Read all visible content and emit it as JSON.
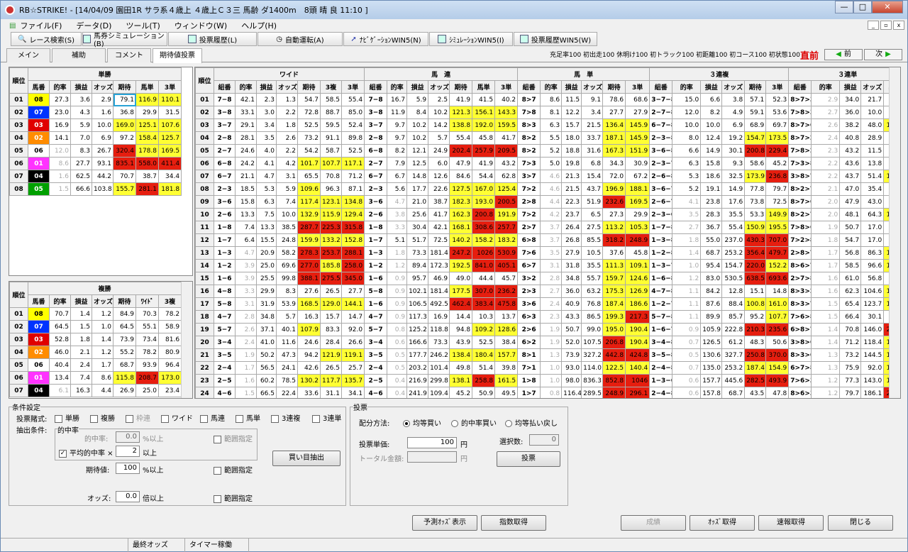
{
  "window": {
    "title": "RB☆STRIKE! - [14/04/09 園田1R サラ系４歳上 ４歳上Ｃ３三 馬齢 ダ1400m　8頭 晴 良 11:10 ]",
    "min": "—",
    "max": "□",
    "close": "✕"
  },
  "menu": [
    "ファイル(F)",
    "データ(D)",
    "ツール(T)",
    "ウィンドウ(W)",
    "ヘルプ(H)"
  ],
  "mdi": [
    "_",
    "▫",
    "x"
  ],
  "toolbar": [
    "レース検索(S)",
    "馬券シミュレーション(B)",
    "投票履歴(L)",
    "自動運転(A)",
    "ﾅﾋﾞｹﾞｰｼｮﾝWIN5(N)",
    "ｼﾐｭﾚｰｼｮﾝWIN5(I)",
    "投票履歴WIN5(W)"
  ],
  "tabs": [
    "メイン",
    "補助",
    "コメント",
    "期待値投票"
  ],
  "status_line": "充足率100 初出走100 休明け100 初トラック100 初距離100 初コース100 初状態100",
  "chokuzen": "直前",
  "nav": {
    "prev": "前",
    "next": "次"
  },
  "colors": {
    "h1": "#ff33ff",
    "h2": "#ff8c00",
    "h3": "#e00000",
    "h4": "#000000",
    "h5": "#00a000",
    "h6": "#ffffff",
    "h7": "#0033ff",
    "h8": "#ffff00"
  },
  "win": {
    "title": "単勝",
    "rank_header": "順位",
    "headers": [
      "馬番",
      "的率",
      "損益",
      "オッズ",
      "期待",
      "馬単",
      "3単"
    ],
    "rows": [
      [
        "01",
        "08",
        "27.3",
        "3.6",
        "2.9",
        "79.1",
        "116.9",
        "110.1"
      ],
      [
        "02",
        "07",
        "23.0",
        "4.3",
        "1.6",
        "36.8",
        "29.9",
        "31.5"
      ],
      [
        "03",
        "03",
        "16.9",
        "5.9",
        "10.0",
        "169.0",
        "125.1",
        "107.6"
      ],
      [
        "04",
        "02",
        "14.1",
        "7.0",
        "6.9",
        "97.2",
        "158.4",
        "125.7"
      ],
      [
        "05",
        "06",
        "12.0",
        "8.3",
        "26.7",
        "320.4",
        "178.8",
        "169.5"
      ],
      [
        "06",
        "01",
        "8.6",
        "27.7",
        "93.1",
        "835.1",
        "558.0",
        "411.4"
      ],
      [
        "07",
        "04",
        "1.6",
        "62.5",
        "44.2",
        "70.7",
        "38.7",
        "34.4"
      ],
      [
        "08",
        "05",
        "1.5",
        "66.6",
        "103.8",
        "155.7",
        "281.1",
        "181.8"
      ]
    ]
  },
  "place": {
    "title": "複勝",
    "rank_header": "順位",
    "headers": [
      "馬番",
      "的率",
      "損益",
      "オッズ",
      "期待",
      "ﾜｲﾄﾞ",
      "3複"
    ],
    "rows": [
      [
        "01",
        "08",
        "70.7",
        "1.4",
        "1.2",
        "84.9",
        "70.3",
        "78.2"
      ],
      [
        "02",
        "07",
        "64.5",
        "1.5",
        "1.0",
        "64.5",
        "55.1",
        "58.9"
      ],
      [
        "03",
        "03",
        "52.8",
        "1.8",
        "1.4",
        "73.9",
        "73.4",
        "81.6"
      ],
      [
        "04",
        "02",
        "46.0",
        "2.1",
        "1.2",
        "55.2",
        "78.2",
        "80.9"
      ],
      [
        "05",
        "06",
        "40.4",
        "2.4",
        "1.7",
        "68.7",
        "93.9",
        "96.4"
      ],
      [
        "06",
        "01",
        "13.4",
        "7.4",
        "8.6",
        "115.8",
        "208.7",
        "173.0"
      ],
      [
        "07",
        "04",
        "6.1",
        "16.3",
        "4.4",
        "26.9",
        "25.0",
        "23.4"
      ]
    ]
  },
  "big": {
    "rank_header": "順位",
    "groups": [
      "ワイド",
      "馬　連",
      "馬　単",
      "３連複",
      "３連単"
    ],
    "sub": [
      "組番",
      "的率",
      "損益",
      "オッズ",
      "期待",
      "3複",
      "3単"
    ],
    "sub_umaren": [
      "組番",
      "的率",
      "損益",
      "オッズ",
      "期待",
      "馬単",
      "3単"
    ],
    "sub_umatan": [
      "組番",
      "的率",
      "損益",
      "オッズ",
      "期待",
      "3単"
    ],
    "sub_sanfuku": [
      "組番",
      "的率",
      "損益",
      "オッズ",
      "期待",
      "3単"
    ],
    "sub_santan": [
      "組番",
      "的率",
      "損益",
      "オッズ",
      "期待"
    ],
    "rows": [
      [
        "01",
        "7−8",
        "42.1",
        "2.3",
        "1.3",
        "54.7",
        "58.5",
        "55.4",
        "7−8",
        "16.7",
        "5.9",
        "2.5",
        "41.9",
        "41.5",
        "40.2",
        "8>7",
        "8.6",
        "11.5",
        "9.1",
        "78.6",
        "68.6",
        "3−7−8",
        "15.0",
        "6.6",
        "3.8",
        "57.1",
        "52.3",
        "8>7>3",
        "2.9",
        "34.0",
        "21.7",
        "63.7"
      ],
      [
        "02",
        "3−8",
        "33.1",
        "3.0",
        "2.2",
        "72.8",
        "88.7",
        "85.0",
        "3−8",
        "11.9",
        "8.4",
        "10.2",
        "121.3",
        "156.1",
        "143.3",
        "7>8",
        "8.1",
        "12.2",
        "3.4",
        "27.7",
        "27.9",
        "2−7−8",
        "12.0",
        "8.2",
        "4.9",
        "59.1",
        "53.6",
        "7>8>3",
        "2.7",
        "36.0",
        "10.0",
        "27.7"
      ],
      [
        "03",
        "3−7",
        "29.1",
        "3.4",
        "1.8",
        "52.5",
        "59.5",
        "52.4",
        "3−7",
        "9.7",
        "10.2",
        "14.2",
        "138.8",
        "192.0",
        "159.5",
        "8>3",
        "6.3",
        "15.7",
        "21.5",
        "136.4",
        "145.9",
        "6−7−8",
        "10.0",
        "10.0",
        "6.9",
        "68.9",
        "69.7",
        "8>7>6",
        "2.6",
        "38.2",
        "48.0",
        "125.5"
      ],
      [
        "04",
        "2−8",
        "28.1",
        "3.5",
        "2.6",
        "73.2",
        "91.1",
        "89.8",
        "2−8",
        "9.7",
        "10.2",
        "5.7",
        "55.4",
        "45.8",
        "41.7",
        "8>2",
        "5.5",
        "18.0",
        "33.7",
        "187.1",
        "145.9",
        "2−3−8",
        "8.0",
        "12.4",
        "19.2",
        "154.7",
        "173.5",
        "8>7>2",
        "2.4",
        "40.8",
        "28.9",
        "70.8"
      ],
      [
        "05",
        "2−7",
        "24.6",
        "4.0",
        "2.2",
        "54.2",
        "58.7",
        "52.5",
        "6−8",
        "8.2",
        "12.1",
        "24.9",
        "202.4",
        "257.9",
        "209.5",
        "8>2",
        "5.2",
        "18.8",
        "31.6",
        "167.3",
        "151.9",
        "3−6−8",
        "6.6",
        "14.9",
        "30.1",
        "200.8",
        "229.4",
        "7>8>2",
        "2.3",
        "43.2",
        "11.5",
        "26.6"
      ],
      [
        "06",
        "6−8",
        "24.2",
        "4.1",
        "4.2",
        "101.7",
        "107.7",
        "117.1",
        "2−7",
        "7.9",
        "12.5",
        "6.0",
        "47.9",
        "41.9",
        "43.2",
        "7>3",
        "5.0",
        "19.8",
        "6.8",
        "34.3",
        "30.9",
        "2−3−7",
        "6.3",
        "15.8",
        "9.3",
        "58.6",
        "45.2",
        "7>3>8",
        "2.2",
        "43.6",
        "13.8",
        "31.6"
      ],
      [
        "07",
        "6−7",
        "21.1",
        "4.7",
        "3.1",
        "65.5",
        "70.8",
        "71.2",
        "6−7",
        "6.7",
        "14.8",
        "12.6",
        "84.6",
        "54.4",
        "62.8",
        "3>7",
        "4.6",
        "21.3",
        "15.4",
        "72.0",
        "67.2",
        "2−6−8",
        "5.3",
        "18.6",
        "32.5",
        "173.9",
        "236.8",
        "3>8>7",
        "2.2",
        "43.7",
        "51.4",
        "117.6"
      ],
      [
        "08",
        "2−3",
        "18.5",
        "5.3",
        "5.9",
        "109.6",
        "96.3",
        "87.1",
        "2−3",
        "5.6",
        "17.7",
        "22.6",
        "127.5",
        "167.0",
        "125.4",
        "7>2",
        "4.6",
        "21.5",
        "43.7",
        "196.9",
        "188.1",
        "3−6−7",
        "5.2",
        "19.1",
        "14.9",
        "77.8",
        "79.7",
        "8>2>7",
        "2.1",
        "47.0",
        "35.4",
        "75.2"
      ],
      [
        "09",
        "3−6",
        "15.8",
        "6.3",
        "7.4",
        "117.4",
        "123.1",
        "134.8",
        "3−6",
        "4.7",
        "21.0",
        "38.7",
        "182.3",
        "193.0",
        "200.5",
        "2>8",
        "4.4",
        "22.3",
        "51.9",
        "232.6",
        "169.5",
        "2−6−7",
        "4.1",
        "23.8",
        "17.6",
        "73.8",
        "72.5",
        "8>7>6",
        "2.0",
        "47.9",
        "43.0",
        "89.6"
      ],
      [
        "10",
        "2−6",
        "13.3",
        "7.5",
        "10.0",
        "132.9",
        "115.9",
        "129.4",
        "2−6",
        "3.8",
        "25.6",
        "41.7",
        "162.3",
        "200.8",
        "191.9",
        "7>2",
        "4.2",
        "23.7",
        "6.5",
        "27.3",
        "29.9",
        "2−3−6",
        "3.5",
        "28.3",
        "35.5",
        "53.3",
        "149.9",
        "8>2>7",
        "2.0",
        "48.1",
        "64.3",
        "133.6"
      ],
      [
        "11",
        "1−8",
        "7.4",
        "13.3",
        "38.5",
        "287.7",
        "225.3",
        "315.8",
        "1−8",
        "3.3",
        "30.4",
        "42.1",
        "168.1",
        "308.6",
        "257.7",
        "2>7",
        "3.7",
        "26.4",
        "27.5",
        "113.2",
        "105.3",
        "1−7−8",
        "2.7",
        "36.7",
        "55.4",
        "150.9",
        "195.5",
        "7>8>6",
        "1.9",
        "50.7",
        "17.0",
        "33.4"
      ],
      [
        "12",
        "1−7",
        "6.4",
        "15.5",
        "24.8",
        "159.9",
        "133.2",
        "152.8",
        "1−7",
        "5.1",
        "51.7",
        "72.5",
        "140.2",
        "158.2",
        "183.2",
        "6>8",
        "3.7",
        "26.8",
        "85.5",
        "318.2",
        "248.9",
        "1−3−8",
        "1.8",
        "55.0",
        "237.0",
        "430.3",
        "707.0",
        "7>2>8",
        "1.8",
        "54.7",
        "17.0",
        "31.0"
      ],
      [
        "13",
        "1−3",
        "4.7",
        "20.9",
        "58.2",
        "278.3",
        "253.7",
        "288.1",
        "1−3",
        "1.8",
        "73.3",
        "181.4",
        "247.2",
        "1026",
        "530.9",
        "7>6",
        "3.5",
        "27.9",
        "10.5",
        "37.6",
        "45.8",
        "1−2−8",
        "1.4",
        "68.7",
        "253.2",
        "356.4",
        "479.7",
        "2>8>7",
        "1.7",
        "56.8",
        "86.3",
        "151.7"
      ],
      [
        "14",
        "1−2",
        "3.9",
        "25.0",
        "69.6",
        "277.0",
        "185.8",
        "258.0",
        "1−2",
        "1.2",
        "89.4",
        "172.3",
        "192.5",
        "841.0",
        "405.1",
        "6>7",
        "3.1",
        "31.8",
        "35.5",
        "111.3",
        "109.1",
        "1−3−7",
        "1.0",
        "95.4",
        "154.7",
        "220.0",
        "152.2",
        "8>6>7",
        "1.7",
        "58.5",
        "96.6",
        "164.9"
      ],
      [
        "15",
        "1−6",
        "3.9",
        "25.5",
        "99.8",
        "388.1",
        "275.5",
        "345.0",
        "1−6",
        "0.9",
        "95.7",
        "46.9",
        "49.0",
        "44.4",
        "45.7",
        "3>2",
        "2.8",
        "34.8",
        "55.7",
        "159.7",
        "124.6",
        "1−6−8",
        "1.2",
        "83.0",
        "530.5",
        "638.5",
        "693.6",
        "2>7>8",
        "1.6",
        "61.0",
        "56.8",
        "93.0"
      ],
      [
        "16",
        "4−8",
        "3.3",
        "29.9",
        "8.3",
        "27.6",
        "26.5",
        "27.7",
        "5−8",
        "0.9",
        "102.1",
        "181.4",
        "177.5",
        "307.0",
        "236.2",
        "2>3",
        "2.7",
        "36.0",
        "63.2",
        "175.3",
        "126.9",
        "4−7−8",
        "1.1",
        "84.2",
        "12.8",
        "15.1",
        "14.8",
        "8>3>2",
        "1.6",
        "62.3",
        "104.6",
        "167.7"
      ],
      [
        "17",
        "5−8",
        "3.1",
        "31.9",
        "53.9",
        "168.5",
        "129.0",
        "144.1",
        "1−6",
        "0.9",
        "106.5",
        "492.5",
        "462.4",
        "383.4",
        "475.8",
        "3>6",
        "2.4",
        "40.9",
        "76.8",
        "187.4",
        "186.6",
        "1−2−7",
        "1.1",
        "87.6",
        "88.4",
        "100.8",
        "161.0",
        "8>3>7",
        "1.5",
        "65.4",
        "123.7",
        "188.8"
      ],
      [
        "18",
        "4−7",
        "2.8",
        "34.8",
        "5.7",
        "16.3",
        "15.7",
        "14.7",
        "4−7",
        "0.9",
        "117.3",
        "16.9",
        "14.4",
        "10.3",
        "13.7",
        "6>3",
        "2.3",
        "43.3",
        "86.5",
        "199.3",
        "217.3",
        "5−7−8",
        "1.1",
        "89.9",
        "85.7",
        "95.2",
        "107.7",
        "7>6>8",
        "1.5",
        "66.4",
        "30.1",
        "45.3"
      ],
      [
        "19",
        "5−7",
        "2.6",
        "37.1",
        "40.1",
        "107.9",
        "83.3",
        "92.0",
        "5−7",
        "0.8",
        "125.2",
        "118.8",
        "94.8",
        "109.2",
        "128.6",
        "2>6",
        "1.9",
        "50.7",
        "99.0",
        "195.0",
        "190.4",
        "1−6−7",
        "0.9",
        "105.9",
        "222.8",
        "210.3",
        "235.6",
        "6>8>7",
        "1.4",
        "70.8",
        "146.0",
        "205.9"
      ],
      [
        "20",
        "3−4",
        "2.4",
        "41.0",
        "11.6",
        "24.6",
        "28.4",
        "26.6",
        "3−4",
        "0.6",
        "166.6",
        "73.3",
        "43.9",
        "52.5",
        "38.4",
        "6>2",
        "1.9",
        "52.0",
        "107.5",
        "206.8",
        "190.4",
        "3−4−8",
        "0.7",
        "126.5",
        "61.2",
        "48.3",
        "50.6",
        "3>8>6",
        "1.4",
        "71.2",
        "118.4",
        "166.1"
      ],
      [
        "21",
        "3−5",
        "1.9",
        "50.2",
        "47.3",
        "94.2",
        "121.9",
        "119.1",
        "3−5",
        "0.5",
        "177.7",
        "246.2",
        "138.4",
        "180.4",
        "157.7",
        "8>1",
        "1.3",
        "73.9",
        "327.2",
        "442.8",
        "424.8",
        "3−5−8",
        "0.5",
        "130.6",
        "327.7",
        "250.8",
        "370.0",
        "8>3>6",
        "1.3",
        "73.2",
        "144.5",
        "197.2"
      ],
      [
        "22",
        "2−4",
        "1.7",
        "56.5",
        "24.1",
        "42.6",
        "26.5",
        "25.7",
        "2−4",
        "0.5",
        "203.2",
        "101.4",
        "49.8",
        "51.4",
        "39.8",
        "7>1",
        "1.0",
        "93.0",
        "114.0",
        "122.5",
        "140.4",
        "2−4−8",
        "0.7",
        "135.0",
        "253.2",
        "187.4",
        "154.9",
        "6>7>8",
        "1.3",
        "75.9",
        "92.0",
        "121.1"
      ],
      [
        "23",
        "2−5",
        "1.6",
        "60.2",
        "78.5",
        "130.2",
        "117.7",
        "135.7",
        "2−5",
        "0.4",
        "216.9",
        "299.8",
        "138.1",
        "258.8",
        "161.5",
        "1>8",
        "1.0",
        "98.0",
        "836.3",
        "852.8",
        "1046",
        "1−3−6",
        "0.6",
        "157.7",
        "445.6",
        "282.5",
        "493.9",
        "7>6>3",
        "1.2",
        "77.3",
        "143.0",
        "184.8"
      ],
      [
        "24",
        "4−6",
        "1.5",
        "66.5",
        "22.4",
        "33.6",
        "31.1",
        "34.1",
        "4−6",
        "0.4",
        "241.9",
        "109.4",
        "45.2",
        "50.9",
        "49.5",
        "1>7",
        "0.8",
        "116.4",
        "289.5",
        "248.9",
        "296.1",
        "2−4−8",
        "0.6",
        "157.8",
        "68.7",
        "43.5",
        "47.8",
        "8>6>3",
        "1.2",
        "79.7",
        "186.1",
        "238.4"
      ]
    ]
  },
  "cond": {
    "title": "条件設定",
    "bet_label": "投票賭式:",
    "bets": [
      "単勝",
      "複勝",
      "枠連",
      "ワイド",
      "馬連",
      "馬単",
      "3連複",
      "3連単"
    ],
    "extract_label": "抽出条件:",
    "hit_group": "的中率",
    "hit_label": "的中率:",
    "hit_val": "0.0",
    "hit_unit": "%以上",
    "range": "範囲指定",
    "avg_label": "平均的中率 ×",
    "avg_val": "2",
    "avg_unit": "以上",
    "exp_label": "期待値:",
    "exp_val": "100",
    "exp_unit": "%以上",
    "odds_label": "オッズ:",
    "odds_val": "0.0",
    "odds_unit": "倍以上",
    "extract_btn": "買い目抽出"
  },
  "vote": {
    "title": "投票",
    "dist_label": "配分方法:",
    "dist": [
      "均等買い",
      "的中率買い",
      "均等払い戻し"
    ],
    "unit_label": "投票単価:",
    "unit_val": "100",
    "yen": "円",
    "total_label": "トータル金額:",
    "sel_label": "選択数:",
    "sel_val": "0",
    "vote_btn": "投票"
  },
  "bottom_btns": [
    "予測ｵｯｽﾞ表示",
    "指数取得",
    "成績",
    "ｵｯｽﾞ取得",
    "速報取得",
    "閉じる"
  ],
  "statusbar": [
    "",
    "最終オッズ",
    "タイマー稼働"
  ]
}
